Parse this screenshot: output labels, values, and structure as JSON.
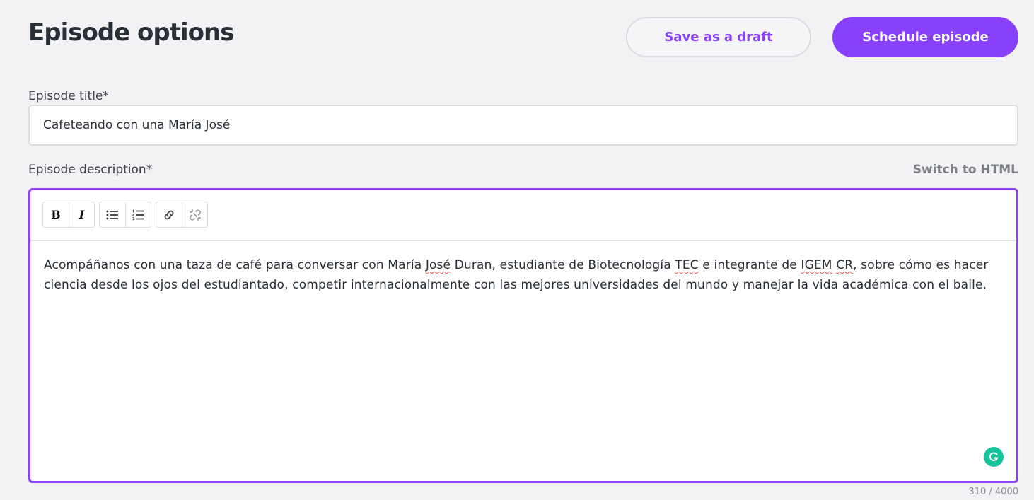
{
  "header": {
    "title": "Episode options",
    "save_draft_label": "Save as a draft",
    "schedule_label": "Schedule episode"
  },
  "episode_title": {
    "label": "Episode title*",
    "value": "Cafeteando con una María José"
  },
  "episode_description": {
    "label": "Episode description*",
    "switch_label": "Switch to HTML",
    "toolbar": [
      {
        "name": "bold-button",
        "icon": "bold-icon",
        "glyph": "B"
      },
      {
        "name": "italic-button",
        "icon": "italic-icon",
        "glyph": "I"
      },
      {
        "name": "bulleted-list-button",
        "icon": "bulleted-list-icon"
      },
      {
        "name": "numbered-list-button",
        "icon": "numbered-list-icon"
      },
      {
        "name": "link-button",
        "icon": "link-icon"
      },
      {
        "name": "unlink-button",
        "icon": "unlink-icon"
      }
    ],
    "text": {
      "p1": "Acompáñanos con una taza de café para conversar con María ",
      "w1": "José",
      "p2": " Duran, estudiante de Biotecnología ",
      "w2": "TEC",
      "p3": " e  integrante de ",
      "w3": "IGEM",
      "p4": " ",
      "w4": "CR",
      "p5": ", sobre cómo es hacer ciencia desde los ojos del estudiantado, competir internacionalmente con las mejores universidades del mundo y manejar la vida académica con el baile."
    },
    "char_count": "310 / 4000"
  },
  "colors": {
    "accent": "#8940fa",
    "background": "#f2f2f4",
    "spellcheck": "#e24c4c",
    "grammarly": "#15c39a"
  }
}
